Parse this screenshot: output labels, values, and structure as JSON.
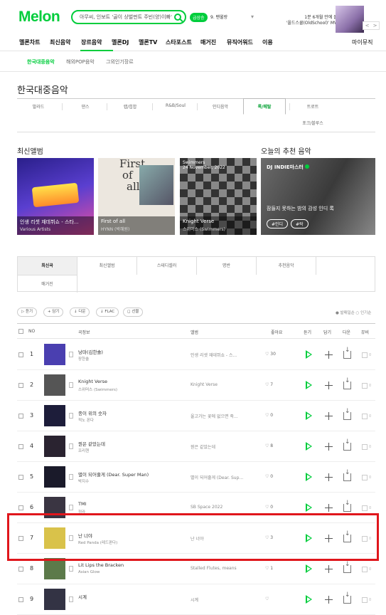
{
  "header": {
    "logo": "Melon",
    "search_text": "아무씨, 인보트 '골이 상벌펀트 주빈(양)이빠'",
    "green_badge": "급상승",
    "rank_text": "9. 팬윌랑",
    "banner_line1": "1분 6개월 만에 돌아온 NTX",
    "banner_line2": "'올드스쿨(OldSchool)' MV 촬영 현장",
    "banner_prev": "<",
    "banner_next": ">"
  },
  "gnb": [
    "멜론차트",
    "최신음악",
    "장르음악",
    "멜론DJ",
    "멜론TV",
    "스타포스트",
    "매거진",
    "뮤직어워드",
    "이용"
  ],
  "gnb_right": "마이뮤직",
  "subnav": [
    "한국대중음악",
    "해외POP음악",
    "그외인기장르"
  ],
  "page_title": "한국대중음악",
  "genre_tabs_row1": [
    "발라드",
    "댄스",
    "랩/힙합",
    "R&B/Soul",
    "인디음악",
    "록/메탈",
    "트로트"
  ],
  "genre_tabs_row2": [
    "포크/블루스"
  ],
  "latest_title": "최신앨범",
  "recommend_title": "오늘의 추천 음악",
  "albums": [
    {
      "title": "인생 리셋 재데뷔쇼 - 스타...",
      "artist": "Various Artists",
      "color": "#3b2fa5"
    },
    {
      "title": "First of all",
      "artist": "HYNN (박혜원)",
      "color": "#e9e4dc"
    },
    {
      "title": "Knight Verse",
      "artist": "스위머스 (Swimmers)",
      "color": "#6a6a6a"
    }
  ],
  "album2_overlay": [
    "First",
    "of",
    "all"
  ],
  "album3_overlay": [
    "Swimmers",
    "24 November, 2022"
  ],
  "recommend": {
    "label": "DJ INDIE마스터",
    "text": "잠들지 못하는 밤의 감성 인디 록",
    "tags": [
      "#인디",
      "#락"
    ]
  },
  "tabbox": [
    "최신곡",
    "최신앨범",
    "스테디셀러",
    "명반",
    "추천음악",
    "매거진"
  ],
  "toolbar": [
    "듣기",
    "담기",
    "다운",
    "FLAC",
    "선물"
  ],
  "sort_text": "● 발매일순  ○ 인기순",
  "table_headers": [
    "NO",
    "곡정보",
    "앨범",
    "좋아요",
    "듣기",
    "담기",
    "다운",
    "뮤비"
  ],
  "rows": [
    {
      "no": "1",
      "title": "낭마(김한솔)",
      "artist": "장한솔",
      "album": "인생 리셋 재데뷔쇼 - 스...",
      "likes": "30",
      "color": "#4a3fb0"
    },
    {
      "no": "2",
      "title": "Knight Verse",
      "artist": "스위머스 (Swimmers)",
      "album": "Knight Verse",
      "likes": "7",
      "color": "#555555"
    },
    {
      "no": "3",
      "title": "종이 위의 숫자",
      "artist": "적노 폰다",
      "album": "울고가는 꽃에 없으면 죽...",
      "likes": "0",
      "color": "#1d1d3a"
    },
    {
      "no": "4",
      "title": "뭔은 같았는데",
      "artist": "프리헨",
      "album": "뭔은 같았는데",
      "likes": "8",
      "color": "#2a2330"
    },
    {
      "no": "5",
      "title": "별이 되어줄게 (Dear. Super Man)",
      "artist": "박지수",
      "album": "별이 되어줄게 (Dear. Sup...",
      "likes": "0",
      "color": "#1a1a2a"
    },
    {
      "no": "6",
      "title": "TMI",
      "artist": "정라",
      "album": "SB Space 2022",
      "likes": "0",
      "color": "#3a3542"
    },
    {
      "no": "7",
      "title": "난 너야",
      "artist": "Red Panda (레드판다)",
      "album": "난 너야",
      "likes": "3",
      "color": "#d9c24a"
    },
    {
      "no": "8",
      "title": "Lit Lips the Bracken",
      "artist": "Asian Glow",
      "album": "Stalled Flutes, means",
      "likes": "1",
      "color": "#5c7a4a"
    },
    {
      "no": "9",
      "title": "시계",
      "artist": "",
      "album": "시계",
      "likes": "",
      "color": "#333344"
    }
  ],
  "mv_label": "0"
}
